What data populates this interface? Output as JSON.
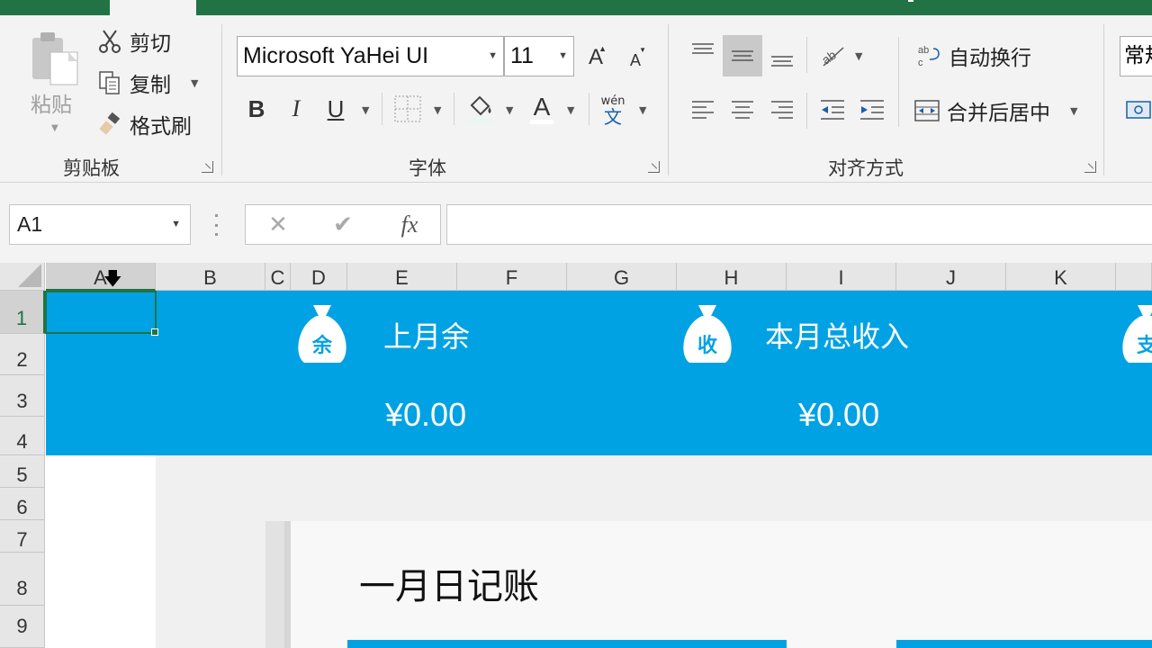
{
  "ribbon": {
    "clipboard": {
      "paste_label": "粘贴",
      "cut_label": "剪切",
      "copy_label": "复制",
      "format_painter_label": "格式刷",
      "group_label": "剪贴板"
    },
    "font": {
      "font_name": "Microsoft YaHei UI",
      "font_size": "11",
      "group_label": "字体",
      "bold": "B",
      "italic": "I",
      "underline": "U",
      "font_color_glyph": "A",
      "phonetic_top": "wén",
      "phonetic_bottom": "文"
    },
    "alignment": {
      "wrap_text_label": "自动换行",
      "merge_center_label": "合并后居中",
      "group_label": "对齐方式"
    },
    "number": {
      "format_label_partial": "常规"
    }
  },
  "formula_bar": {
    "name_box": "A1",
    "fx_label": "fx",
    "formula": ""
  },
  "columns": [
    "A",
    "B",
    "C",
    "D",
    "E",
    "F",
    "G",
    "H",
    "I",
    "J",
    "K"
  ],
  "rows": [
    "1",
    "2",
    "3",
    "4",
    "5",
    "6",
    "7",
    "8",
    "9"
  ],
  "dashboard": {
    "stats": [
      {
        "icon_char": "余",
        "label": "上月余",
        "value": "¥0.00"
      },
      {
        "icon_char": "收",
        "label": "本月总收入",
        "value": "¥0.00"
      },
      {
        "icon_char": "支",
        "label": "",
        "value": ""
      }
    ],
    "sheet_title": "一月日记账"
  },
  "colors": {
    "excel_green": "#217346",
    "band_blue": "#00a2e3"
  }
}
